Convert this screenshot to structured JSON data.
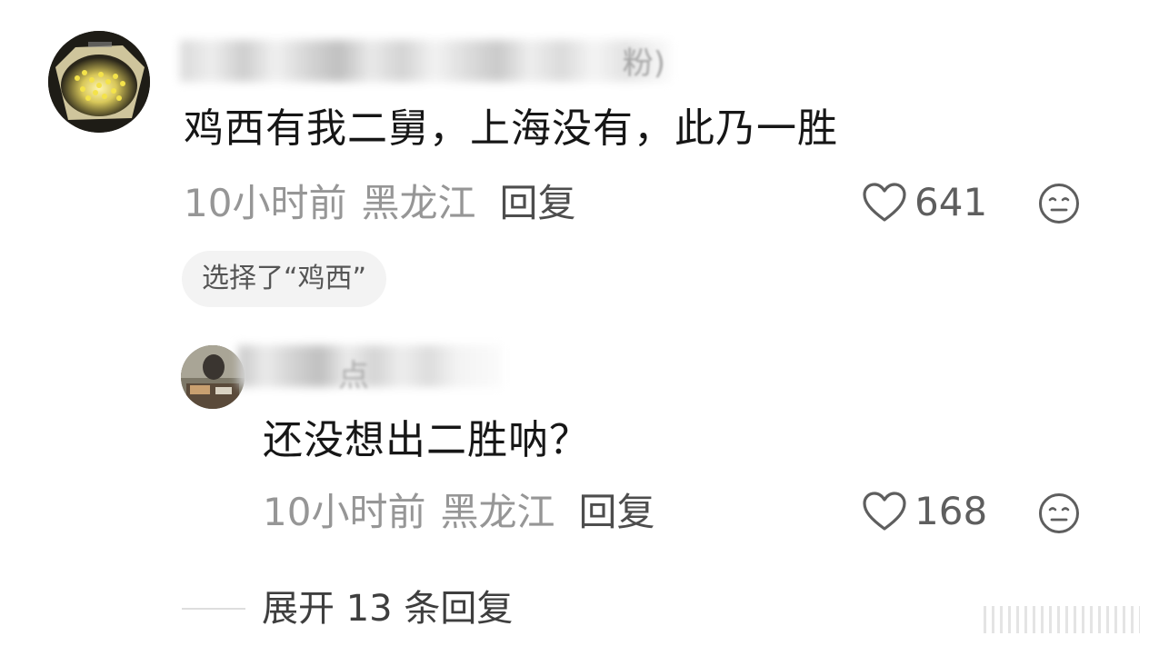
{
  "comment": {
    "username_tail": "粉)",
    "text": "鸡西有我二舅，上海没有，此乃一胜",
    "time": "10小时前",
    "location": "黑龙江",
    "reply_label": "回复",
    "likes": "641",
    "vote_chip": "选择了“鸡西”"
  },
  "reply": {
    "username_tail": "点",
    "text": "还没想出二胜呐？",
    "time": "10小时前",
    "location": "黑龙江",
    "reply_label": "回复",
    "likes": "168"
  },
  "expand": {
    "label": "展开 13 条回复"
  },
  "icons": {
    "like": "heart-outline-icon",
    "dislike": "neutral-face-icon"
  },
  "colors": {
    "text": "#161616",
    "meta": "#969696",
    "chip_bg": "#f3f3f3"
  }
}
